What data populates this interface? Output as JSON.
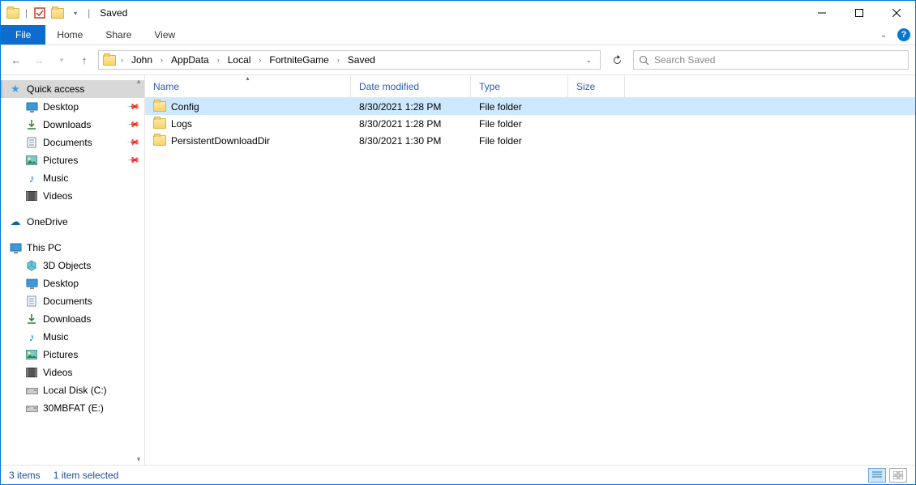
{
  "titlebar": {
    "title": "Saved"
  },
  "ribbon": {
    "file": "File",
    "home": "Home",
    "share": "Share",
    "view": "View"
  },
  "breadcrumb": [
    "John",
    "AppData",
    "Local",
    "FortniteGame",
    "Saved"
  ],
  "search": {
    "placeholder": "Search Saved"
  },
  "sidebar": {
    "quickAccess": "Quick access",
    "quick": [
      {
        "label": "Desktop",
        "pin": true,
        "icon": "desktop"
      },
      {
        "label": "Downloads",
        "pin": true,
        "icon": "downloads"
      },
      {
        "label": "Documents",
        "pin": true,
        "icon": "documents"
      },
      {
        "label": "Pictures",
        "pin": true,
        "icon": "pictures"
      },
      {
        "label": "Music",
        "pin": false,
        "icon": "music"
      },
      {
        "label": "Videos",
        "pin": false,
        "icon": "videos"
      }
    ],
    "onedrive": "OneDrive",
    "thispc": "This PC",
    "pc": [
      {
        "label": "3D Objects",
        "icon": "3d"
      },
      {
        "label": "Desktop",
        "icon": "desktop"
      },
      {
        "label": "Documents",
        "icon": "documents"
      },
      {
        "label": "Downloads",
        "icon": "downloads"
      },
      {
        "label": "Music",
        "icon": "music"
      },
      {
        "label": "Pictures",
        "icon": "pictures"
      },
      {
        "label": "Videos",
        "icon": "videos"
      },
      {
        "label": "Local Disk (C:)",
        "icon": "disk"
      },
      {
        "label": "30MBFAT (E:)",
        "icon": "disk"
      }
    ]
  },
  "columns": {
    "name": "Name",
    "date": "Date modified",
    "type": "Type",
    "size": "Size"
  },
  "files": [
    {
      "name": "Config",
      "date": "8/30/2021 1:28 PM",
      "type": "File folder",
      "size": "",
      "selected": true
    },
    {
      "name": "Logs",
      "date": "8/30/2021 1:28 PM",
      "type": "File folder",
      "size": "",
      "selected": false
    },
    {
      "name": "PersistentDownloadDir",
      "date": "8/30/2021 1:30 PM",
      "type": "File folder",
      "size": "",
      "selected": false
    }
  ],
  "status": {
    "count": "3 items",
    "selected": "1 item selected"
  }
}
